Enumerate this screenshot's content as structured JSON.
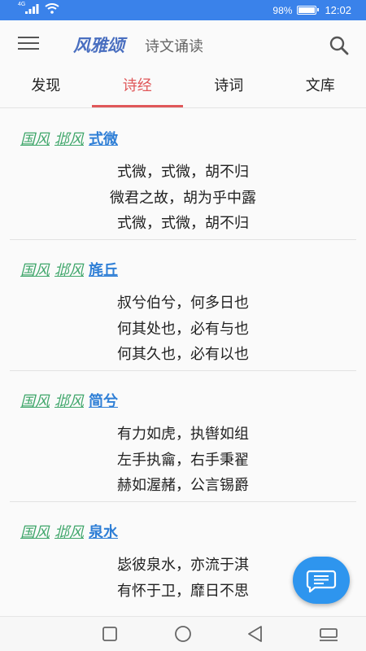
{
  "status_bar": {
    "network": "4G",
    "battery": "98%",
    "battery_level": 0.98,
    "time": "12:02",
    "color": "#3a82ea"
  },
  "app_bar": {
    "title": "风雅颂",
    "subtitle": "诗文诵读",
    "menu_icon": "hamburger-menu-icon",
    "search_icon": "search-icon"
  },
  "tabs": [
    {
      "label": "发现",
      "active": false
    },
    {
      "label": "诗经",
      "active": true
    },
    {
      "label": "诗词",
      "active": false
    },
    {
      "label": "文库",
      "active": false
    }
  ],
  "poems": [
    {
      "category": "国风",
      "section": "邶风",
      "title": "式微",
      "lines": [
        "式微，式微，胡不归",
        "微君之故，胡为乎中露",
        "式微，式微，胡不归"
      ]
    },
    {
      "category": "国风",
      "section": "邶风",
      "title": "旄丘",
      "lines": [
        "叔兮伯兮，何多日也",
        "何其处也，必有与也",
        "何其久也，必有以也"
      ]
    },
    {
      "category": "国风",
      "section": "邶风",
      "title": "简兮",
      "lines": [
        "有力如虎，执辔如组",
        "左手执龠，右手秉翟",
        "赫如渥赭，公言锡爵"
      ]
    },
    {
      "category": "国风",
      "section": "邶风",
      "title": "泉水",
      "lines": [
        "毖彼泉水，亦流于淇",
        "有怀于卫，靡日不思",
        ""
      ]
    }
  ],
  "fab_icon": "message-icon",
  "nav_bar": {
    "icons": [
      "recent-apps-icon",
      "home-icon",
      "back-icon",
      "notification-shade-icon"
    ]
  },
  "colors": {
    "accent": "#e0585a",
    "brand": "#4a6fc0",
    "crumb": "#3fa66a",
    "title_link": "#2f7fd6",
    "fab": "#2e95ee"
  }
}
